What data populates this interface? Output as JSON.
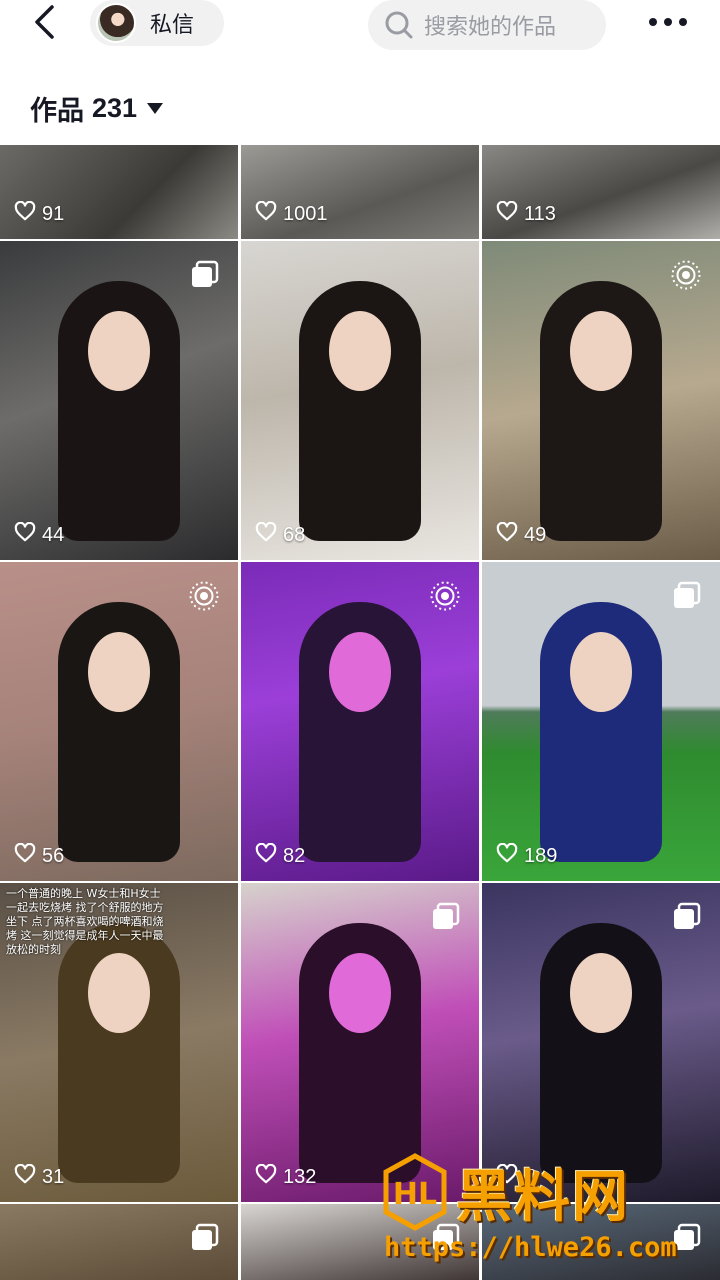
{
  "topbar": {
    "back_icon": "chevron-left-icon",
    "private_message_label": "私信",
    "search_placeholder": "搜索她的作品",
    "more_icon": "more-horizontal-icon"
  },
  "works": {
    "title": "作品",
    "count": "231"
  },
  "grid": {
    "tiles": [
      {
        "likes": "91",
        "badge": null
      },
      {
        "likes": "1001",
        "badge": null
      },
      {
        "likes": "113",
        "badge": null
      },
      {
        "likes": "44",
        "badge": "multi-image-icon"
      },
      {
        "likes": "68",
        "badge": null
      },
      {
        "likes": "49",
        "badge": "live-photo-icon"
      },
      {
        "likes": "56",
        "badge": "live-photo-icon"
      },
      {
        "likes": "82",
        "badge": "live-photo-icon"
      },
      {
        "likes": "189",
        "badge": "multi-image-icon"
      },
      {
        "likes": "31",
        "badge": null,
        "overlay_text": "一个普通的晚上 W女士和H女士 一起去吃烧烤 找了个舒服的地方坐下 点了两杯喜欢喝的啤酒和烧烤 这一刻觉得是成年人一天中最放松的时刻"
      },
      {
        "likes": "132",
        "badge": "multi-image-icon"
      },
      {
        "likes": "5",
        "badge": "multi-image-icon"
      },
      {
        "likes": "",
        "badge": "multi-image-icon"
      },
      {
        "likes": "",
        "badge": "multi-image-icon"
      },
      {
        "likes": "",
        "badge": "multi-image-icon"
      }
    ]
  },
  "watermark": {
    "title": "黑料网",
    "url": "https://hlwe26.com"
  },
  "colors": {
    "text_primary": "#161823",
    "pill_bg": "#f1f1f2",
    "placeholder": "#9a9ca3",
    "watermark": "#f5a000"
  }
}
